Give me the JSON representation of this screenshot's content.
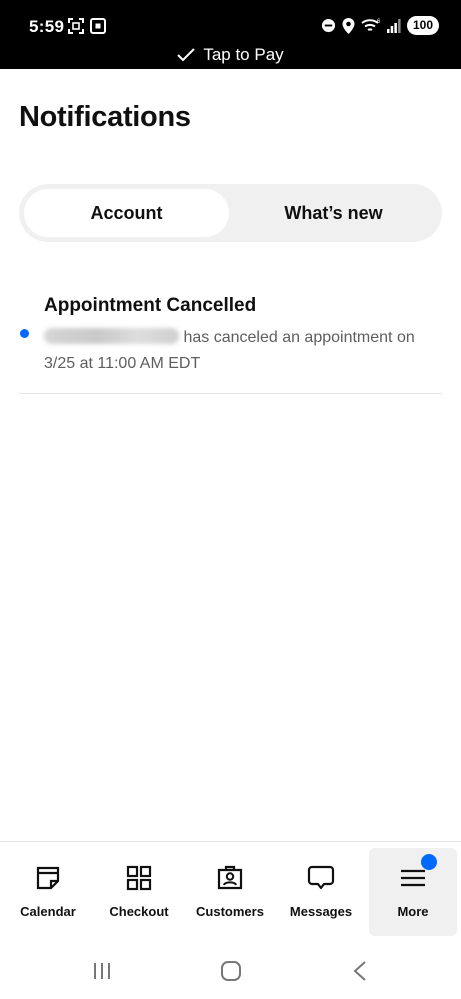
{
  "status_bar": {
    "time": "5:59",
    "battery": "100",
    "banner": "Tap to Pay"
  },
  "page": {
    "title": "Notifications"
  },
  "tabs": [
    {
      "label": "Account",
      "active": true
    },
    {
      "label": "What’s new",
      "active": false
    }
  ],
  "notifications": [
    {
      "title": "Appointment Cancelled",
      "body": "has canceled an appointment on 3/25 at 11:00 AM EDT",
      "unread": true
    }
  ],
  "bottom_nav": {
    "items": [
      {
        "label": "Calendar",
        "icon": "calendar-icon"
      },
      {
        "label": "Checkout",
        "icon": "grid-icon"
      },
      {
        "label": "Customers",
        "icon": "customers-icon"
      },
      {
        "label": "Messages",
        "icon": "message-icon"
      },
      {
        "label": "More",
        "icon": "menu-icon",
        "selected": true,
        "badge": true
      }
    ]
  },
  "colors": {
    "accent": "#006aff",
    "status_bar_bg": "#000000",
    "segment_bg": "#f0f0f0"
  }
}
